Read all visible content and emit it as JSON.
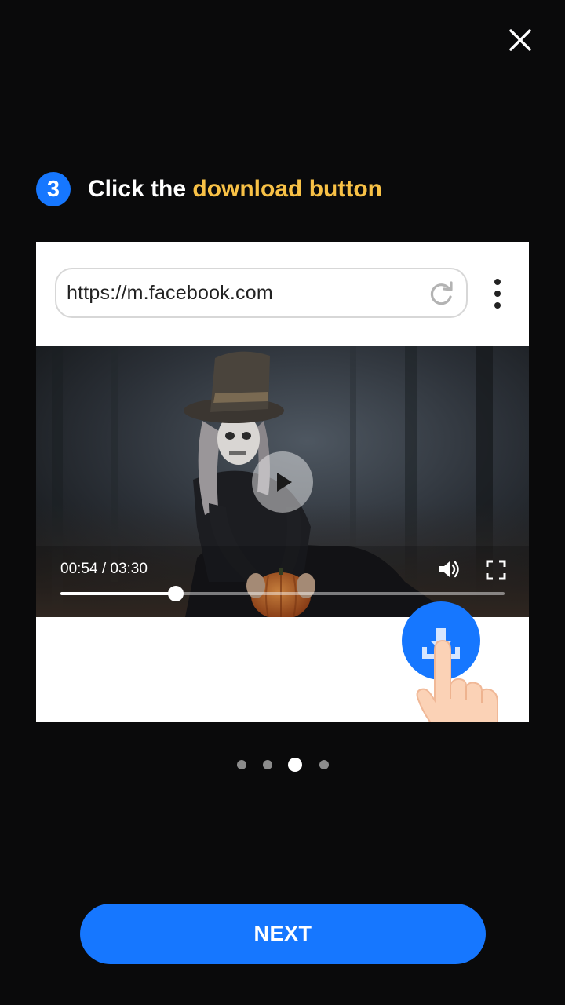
{
  "header": {
    "close_icon": "close-icon"
  },
  "step": {
    "number": "3",
    "title_prefix": "Click the ",
    "title_highlight": "download button",
    "highlight_color": "#f8c146",
    "badge_color": "#1677ff"
  },
  "browser": {
    "url": "https://m.facebook.com",
    "reload_icon": "reload-icon",
    "menu_icon": "vertical-dots-menu-icon"
  },
  "video": {
    "current_time": "00:54",
    "duration": "03:30",
    "time_display": "00:54 / 03:30",
    "progress": 0.26,
    "icons": [
      "play-icon",
      "volume-icon",
      "fullscreen-icon"
    ]
  },
  "download": {
    "icon": "download-icon",
    "pointer_icon": "pointing-hand-icon",
    "color": "#1677ff"
  },
  "pagination": {
    "total": 4,
    "active_index": 2
  },
  "footer": {
    "next_label": "NEXT"
  }
}
